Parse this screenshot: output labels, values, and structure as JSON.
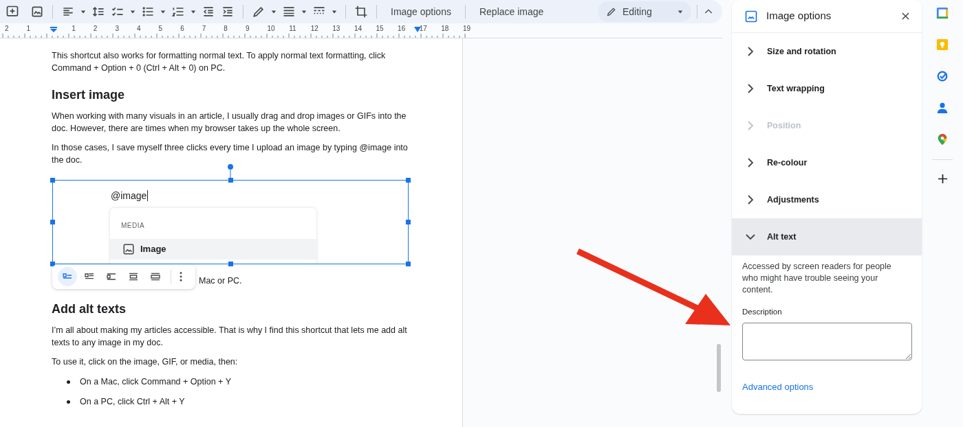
{
  "toolbar": {
    "text_buttons": [
      "Image options",
      "Replace image"
    ],
    "mode": {
      "label": "Editing"
    }
  },
  "ruler": {
    "numbers": [
      "2",
      "1",
      "1",
      "2",
      "3",
      "4",
      "5",
      "6",
      "7",
      "8",
      "9",
      "10",
      "11",
      "12",
      "13",
      "14",
      "15",
      "16",
      "17",
      "18",
      "19"
    ]
  },
  "document": {
    "blocks": [
      {
        "kind": "paragraph",
        "text": "This shortcut also works for formatting normal text. To apply normal text formatting, click Command + Option + 0 (Ctrl + Alt + 0) on PC."
      },
      {
        "kind": "heading",
        "text": "Insert image"
      },
      {
        "kind": "paragraph",
        "text": "When working with many visuals in an article, I usually drag and drop images or GIFs into the doc. However, there are times when my browser takes up the whole screen."
      },
      {
        "kind": "paragraph",
        "text": "In those cases, I save myself three clicks every time I upload an image by typing @image into the doc."
      },
      {
        "kind": "image",
        "typed": "@image",
        "menu_heading": "MEDIA",
        "menu_item": "Image"
      },
      {
        "kind": "partial",
        "text": "Mac or PC."
      },
      {
        "kind": "heading",
        "text": "Add alt texts"
      },
      {
        "kind": "paragraph",
        "text": "I’m all about making my articles accessible. That is why I find this shortcut that lets me add alt texts to any image in my doc."
      },
      {
        "kind": "paragraph",
        "text": "To use it, click on the image, GIF, or media, then:"
      },
      {
        "kind": "bullet",
        "text": "On a Mac, click Command + Option + Y"
      },
      {
        "kind": "bullet",
        "text": "On a PC, click Ctrl + Alt + Y"
      }
    ]
  },
  "wrap_toolbar": {
    "options": [
      {
        "selected": true
      },
      {
        "selected": false
      },
      {
        "selected": false
      },
      {
        "selected": false
      },
      {
        "selected": false
      }
    ]
  },
  "panel": {
    "title": "Image options",
    "sections": [
      {
        "label": "Size and rotation",
        "expanded": false,
        "disabled": false
      },
      {
        "label": "Text wrapping",
        "expanded": false,
        "disabled": false
      },
      {
        "label": "Position",
        "expanded": false,
        "disabled": true
      },
      {
        "label": "Re-colour",
        "expanded": false,
        "disabled": false
      },
      {
        "label": "Adjustments",
        "expanded": false,
        "disabled": false
      },
      {
        "label": "Alt text",
        "expanded": true,
        "disabled": false
      }
    ],
    "alt_text": {
      "help": "Accessed by screen readers for people who might have trouble seeing your content.",
      "field_label": "Description",
      "link": "Advanced options"
    }
  }
}
